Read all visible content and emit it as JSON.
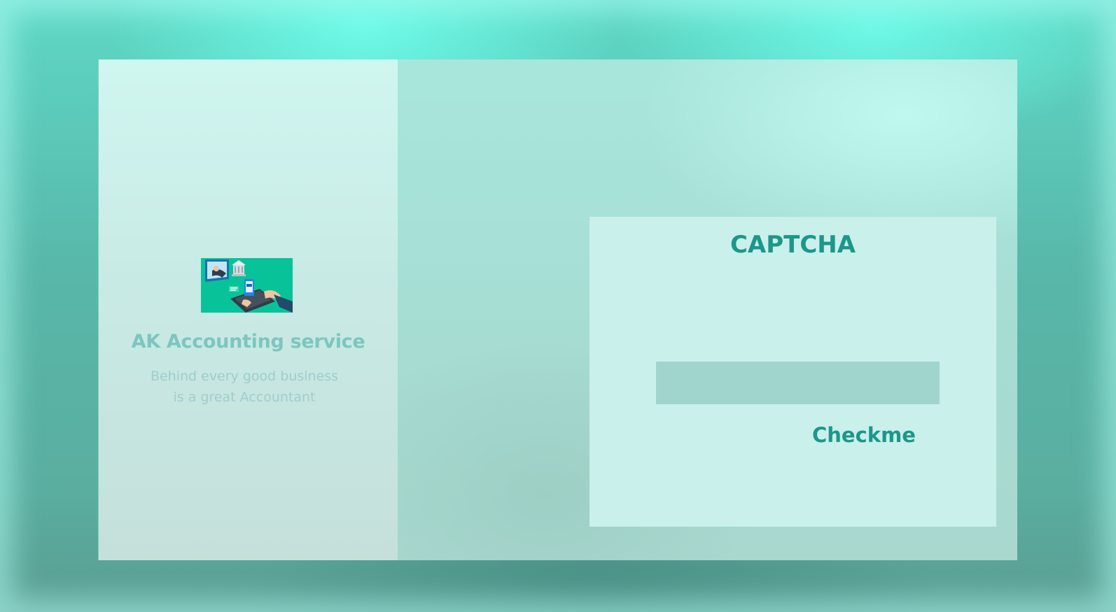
{
  "brand": {
    "name": "AK Accounting service",
    "tagline_line1": "Behind every good business",
    "tagline_line2": "is a great Accountant",
    "logo_icon": "online-banking-illustration-icon"
  },
  "captcha": {
    "title": "CAPTCHA",
    "input_value": "",
    "input_placeholder": "",
    "button_label": "Checkme"
  },
  "colors": {
    "accent": "#1c978a",
    "brand_title": "#7cc6bf",
    "tagline": "#9fcdca",
    "input_bg": "#a0d5cd",
    "logo_bg": "#08c399"
  }
}
